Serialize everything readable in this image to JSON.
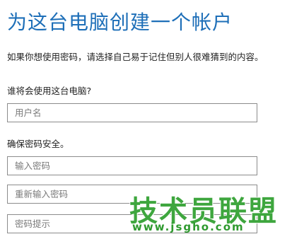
{
  "page": {
    "title": "为这台电脑创建一个帐户",
    "description": "如果你想使用密码，请选择自己易于记住但别人很难猜到的内容。"
  },
  "user_section": {
    "label": "谁将会使用这台电脑?",
    "username_placeholder": "用户名",
    "username_value": ""
  },
  "password_section": {
    "label": "确保密码安全。",
    "password_placeholder": "输入密码",
    "confirm_placeholder": "重新输入密码",
    "hint_placeholder": "密码提示"
  },
  "watermark": {
    "text": "技术员联盟",
    "url": "www.jsgho.com",
    "color": "#3ea63e"
  },
  "colors": {
    "title": "#1e6fb8",
    "field_border": "#8c8c8c",
    "placeholder": "#7a7a7a"
  }
}
